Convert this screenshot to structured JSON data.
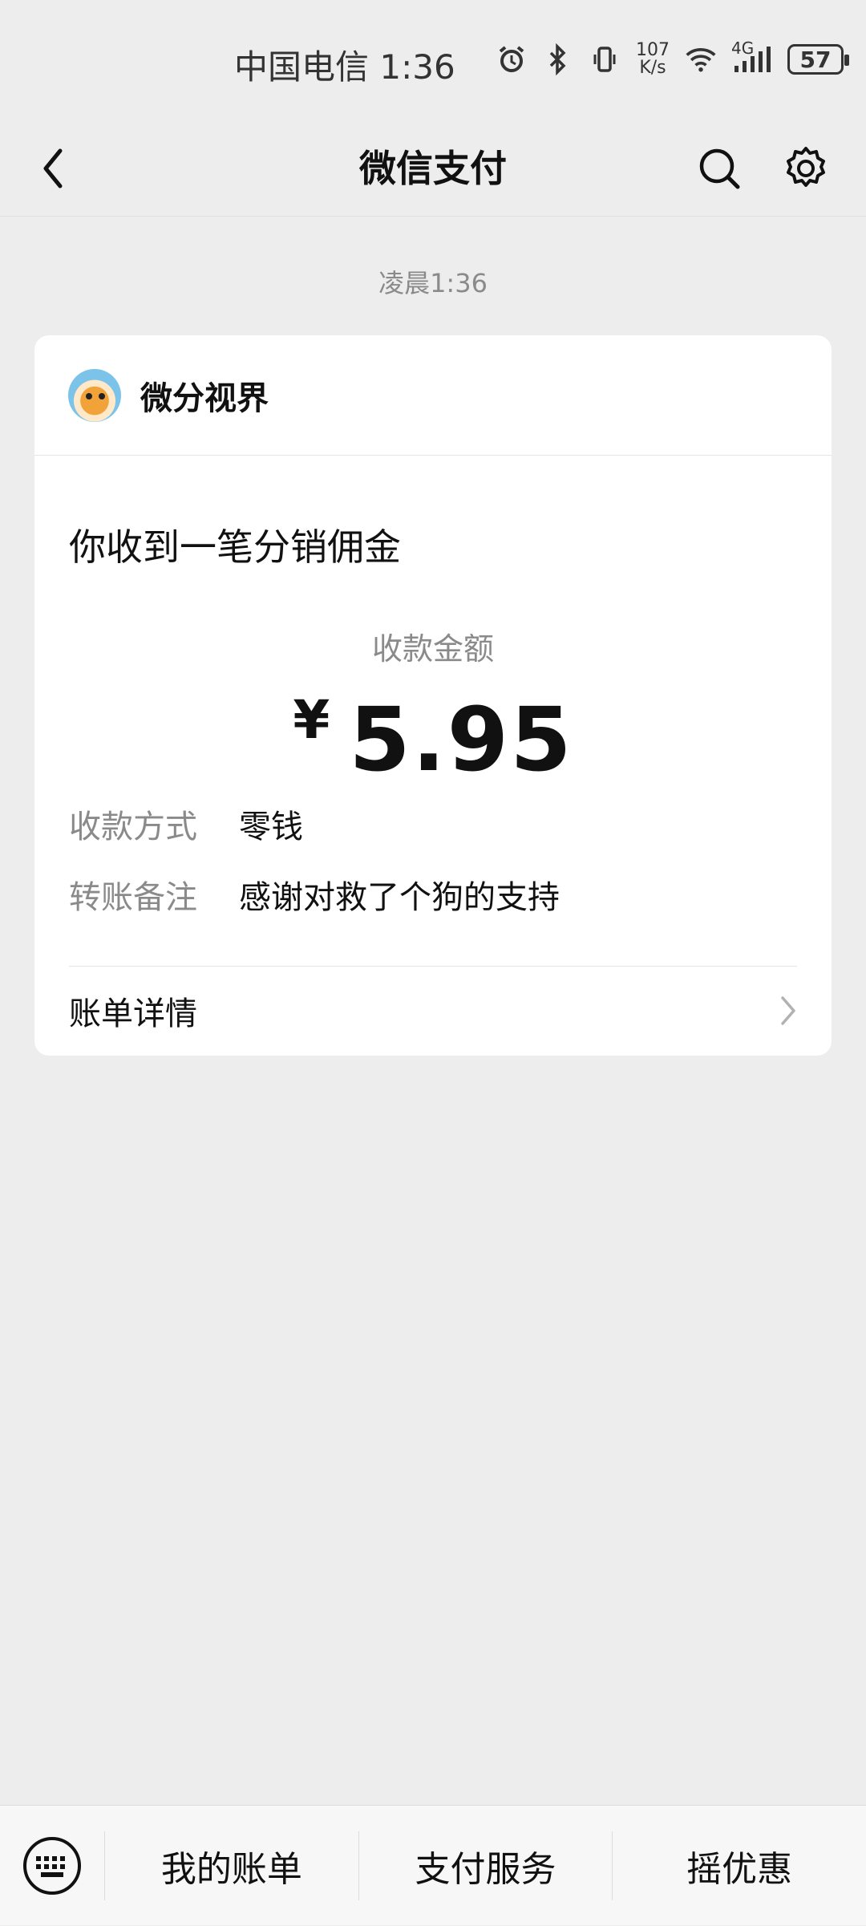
{
  "status_bar": {
    "carrier_time": "中国电信 1:36",
    "net_speed_value": "107",
    "net_speed_unit": "K/s",
    "network": "4G",
    "battery": "57"
  },
  "nav": {
    "title": "微信支付"
  },
  "message": {
    "time": "凌晨1:36",
    "merchant": "微分视界",
    "title": "你收到一笔分销佣金",
    "amount_label": "收款金额",
    "currency": "¥",
    "amount": "5.95",
    "rows": [
      {
        "label": "收款方式",
        "value": "零钱"
      },
      {
        "label": "转账备注",
        "value": "感谢对救了个狗的支持"
      }
    ],
    "detail_link": "账单详情"
  },
  "bottom_menu": {
    "items": [
      "我的账单",
      "支付服务",
      "摇优惠"
    ]
  }
}
